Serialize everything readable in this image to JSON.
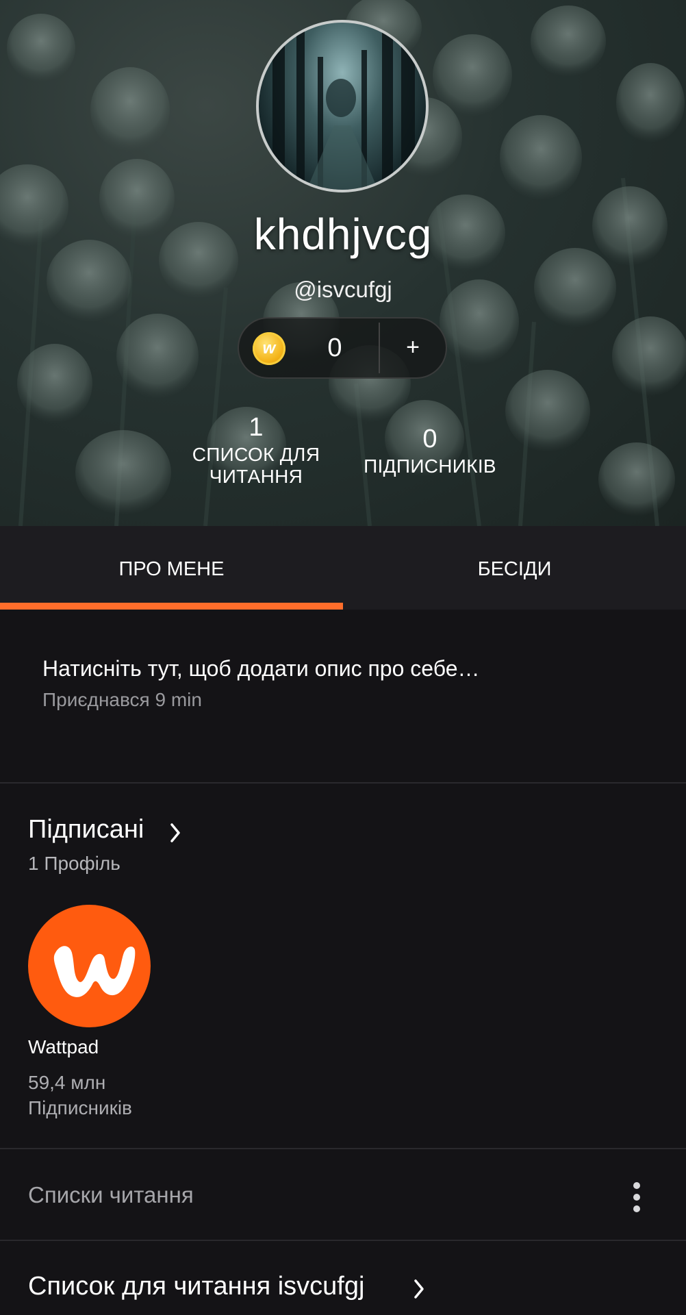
{
  "profile": {
    "display_name": "khdhjvcg",
    "handle": "@isvcufgj",
    "coins": "0",
    "coin_icon": "wattpad-coin-icon",
    "add_label": "+",
    "stats": {
      "reading_lists_count": "1",
      "reading_lists_label_line1": "СПИСОК ДЛЯ",
      "reading_lists_label_line2": "ЧИТАННЯ",
      "followers_count": "0",
      "followers_label": "ПІДПИСНИКІВ"
    }
  },
  "tabs": [
    {
      "label": "ПРО МЕНЕ",
      "active": true
    },
    {
      "label": "БЕСІДИ",
      "active": false
    }
  ],
  "about": {
    "description_prompt": "Натисніть тут, щоб додати опис про себе…",
    "joined": "Приєднався 9 min"
  },
  "following": {
    "title": "Підписані",
    "count": "1 Профіль",
    "items": [
      {
        "name": "Wattpad",
        "followers": "59,4 млн",
        "followers_label": "Підписників"
      }
    ]
  },
  "reading_lists": {
    "title": "Списки читання",
    "lists": [
      {
        "title": "Список для читання isvcufgj"
      }
    ]
  },
  "colors": {
    "accent": "#ff6d2b",
    "background": "#141316",
    "tabs_background": "#1d1c20",
    "wattpad_brand": "#ff5b0f"
  }
}
